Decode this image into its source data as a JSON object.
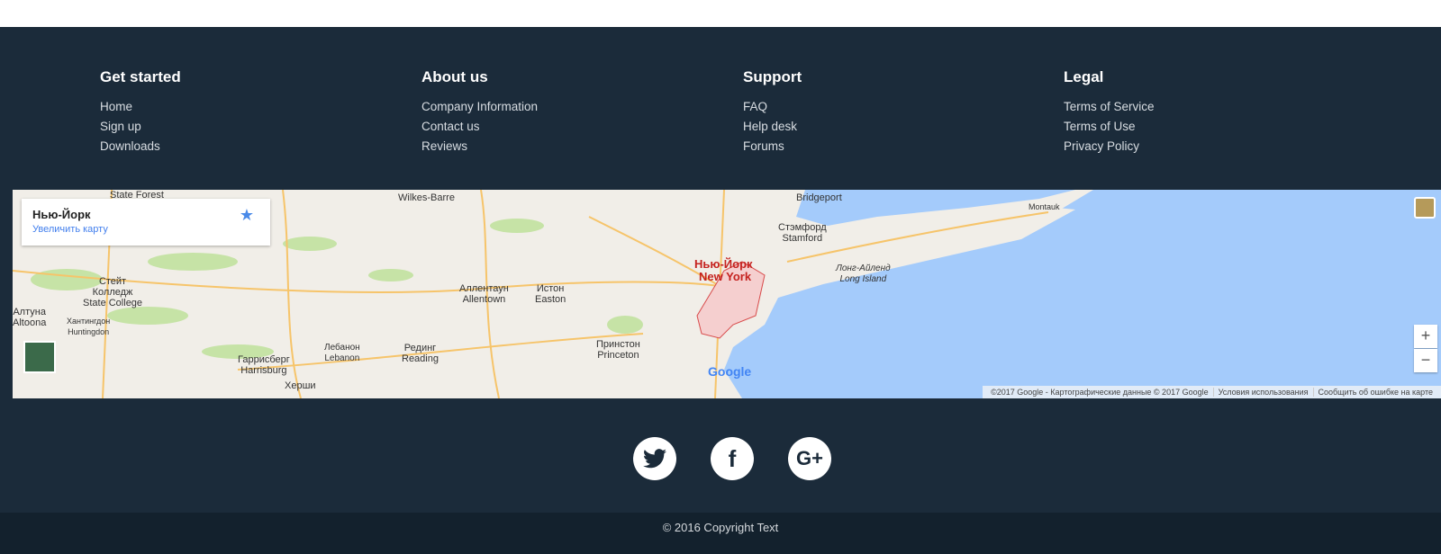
{
  "columns": [
    {
      "title": "Get started",
      "links": [
        "Home",
        "Sign up",
        "Downloads"
      ]
    },
    {
      "title": "About us",
      "links": [
        "Company Information",
        "Contact us",
        "Reviews"
      ]
    },
    {
      "title": "Support",
      "links": [
        "FAQ",
        "Help desk",
        "Forums"
      ]
    },
    {
      "title": "Legal",
      "links": [
        "Terms of Service",
        "Terms of Use",
        "Privacy Policy"
      ]
    }
  ],
  "map": {
    "place_title": "Нью-Йорк",
    "enlarge_link": "Увеличить карту",
    "labels": {
      "ny": "Нью-Йорк",
      "ny_en": "New York",
      "allentown": "Аллентаун\nAllentown",
      "easton": "Истон\nEaston",
      "princeton": "Принстон\nPrinceton",
      "reading": "Рединг\nReading",
      "harrisburg": "Гаррисберг\nHarrisburg",
      "lebanon": "Лебанон\nLebanon",
      "stamford": "Стэмфорд\nStamford",
      "bridgeport": "Bridgeport",
      "long_island": "Лонг-Айленд\nLong Island",
      "montauk": "Montauk",
      "state_college": "Стейт\nКолледж\nState College",
      "altoona": "Алтуна\nAltoona",
      "huntingdon": "Хантингдон\nHuntingdon",
      "wilkes": "Wilkes-Barre",
      "state_forest": "State Forest",
      "hershey": "Херши"
    },
    "zoom_in": "+",
    "zoom_out": "−",
    "logo": "Google",
    "attribution": [
      "©2017 Google - Картографические данные © 2017 Google",
      "Условия использования",
      "Сообщить об ошибке на карте"
    ],
    "colors": {
      "water": "#a4cbfb",
      "land": "#f1eee8",
      "road": "#f6c46a",
      "park": "#c6e3a6"
    }
  },
  "social": [
    {
      "icon": "twitter-icon",
      "glyph": "🐦"
    },
    {
      "icon": "facebook-icon",
      "glyph": "f"
    },
    {
      "icon": "google-plus-icon",
      "glyph": "G+"
    }
  ],
  "copyright": "© 2016 Copyright Text"
}
